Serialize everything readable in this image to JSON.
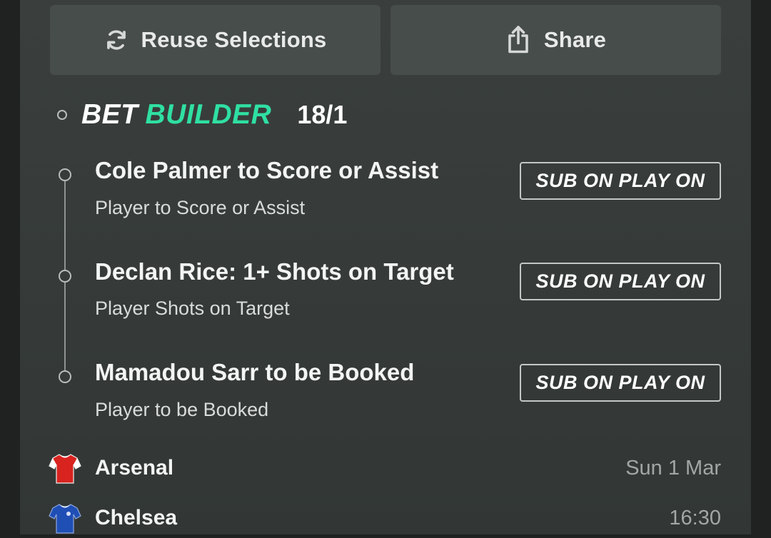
{
  "actions": {
    "reuse_label": "Reuse Selections",
    "share_label": "Share"
  },
  "bet_builder": {
    "word_bet": "BET",
    "word_builder": "BUILDER",
    "odds": "18/1",
    "accent_color": "#2fe0a2"
  },
  "selections": [
    {
      "title": "Cole Palmer to Score or Assist",
      "market": "Player to Score or Assist",
      "badge": "SUB ON PLAY ON"
    },
    {
      "title": "Declan Rice: 1+ Shots on Target",
      "market": "Player Shots on Target",
      "badge": "SUB ON PLAY ON"
    },
    {
      "title": "Mamadou Sarr to be Booked",
      "market": "Player to be Booked",
      "badge": "SUB ON PLAY ON"
    }
  ],
  "match": {
    "home": {
      "name": "Arsenal",
      "kit_color": "#d8231f",
      "kit_icon": "red-shirt-icon"
    },
    "away": {
      "name": "Chelsea",
      "kit_color": "#1f4fb5",
      "kit_icon": "blue-shirt-icon"
    },
    "date": "Sun 1 Mar",
    "time": "16:30"
  }
}
